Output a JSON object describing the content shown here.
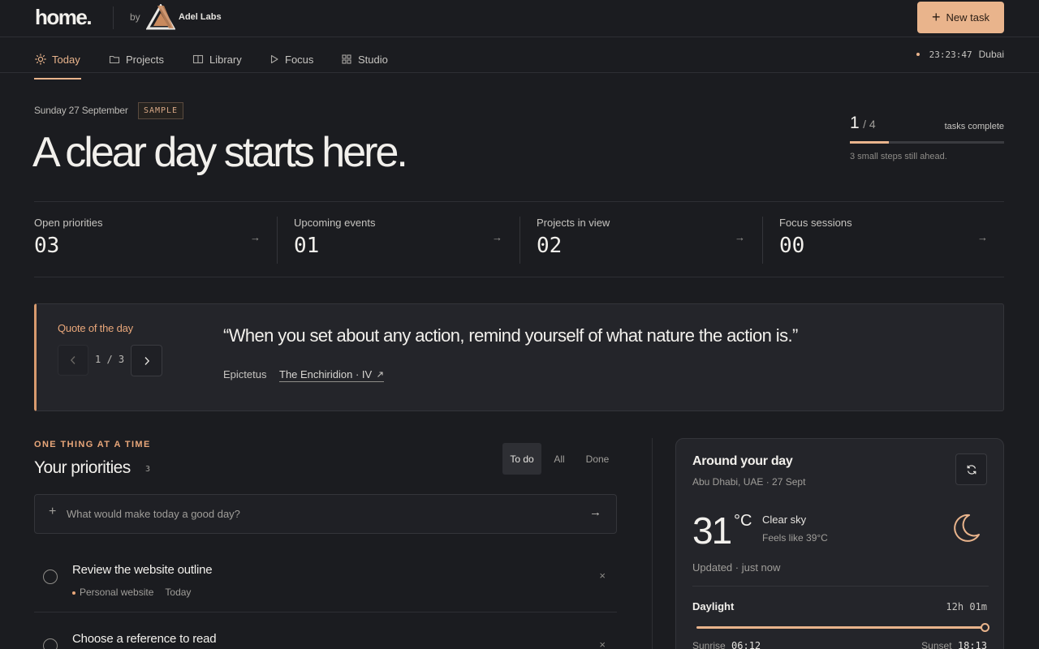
{
  "header": {
    "brand": "home.",
    "by": "by",
    "company": "Adel Labs",
    "new_task_label": "New task"
  },
  "nav": {
    "items": [
      {
        "label": "Today",
        "icon": "sun-icon",
        "active": true
      },
      {
        "label": "Projects",
        "icon": "folder-icon"
      },
      {
        "label": "Library",
        "icon": "book-icon"
      },
      {
        "label": "Focus",
        "icon": "play-icon"
      },
      {
        "label": "Studio",
        "icon": "grid-icon"
      }
    ],
    "time": "23:23:47",
    "city": "Dubai"
  },
  "hero": {
    "date": "Sunday 27 September",
    "badge": "SAMPLE",
    "headline": "A clear day starts here.",
    "progress": {
      "done": "1",
      "total": "/ 4",
      "label": "tasks complete",
      "fraction": 0.25,
      "note": "3 small steps still ahead."
    }
  },
  "stats": [
    {
      "label": "Open priorities",
      "value": "03"
    },
    {
      "label": "Upcoming events",
      "value": "01"
    },
    {
      "label": "Projects in view",
      "value": "02"
    },
    {
      "label": "Focus sessions",
      "value": "00"
    }
  ],
  "quote": {
    "label": "Quote of the day",
    "position": "1 / 3",
    "text": "“When you set about any action, remind yourself of what nature the action is.”",
    "author": "Epictetus",
    "source": "The Enchiridion · IV"
  },
  "priorities": {
    "kicker": "ONE THING AT A TIME",
    "title": "Your priorities",
    "count": "3",
    "filters": [
      "To do",
      "All",
      "Done"
    ],
    "add_placeholder": "What would make today a good day?",
    "tasks": [
      {
        "title": "Review the website outline",
        "project": "Personal website",
        "due": "Today"
      },
      {
        "title": "Choose a reference to read",
        "project": "",
        "due": ""
      }
    ]
  },
  "weather": {
    "title": "Around your day",
    "location": "Abu Dhabi, UAE · 27 Sept",
    "temp": "31",
    "unit": "°C",
    "condition": "Clear sky",
    "feels": "Feels like 39°C",
    "updated": "Updated · just now",
    "daylight_label": "Daylight",
    "daylight_hours": "12h 01m",
    "daylight_fraction": 1.0,
    "sunrise_label": "Sunrise",
    "sunrise": "06:12",
    "sunset_label": "Sunset",
    "sunset": "18:13"
  },
  "colors": {
    "accent": "#e9b48c",
    "background": "#1b1c20",
    "card": "#24252a"
  }
}
